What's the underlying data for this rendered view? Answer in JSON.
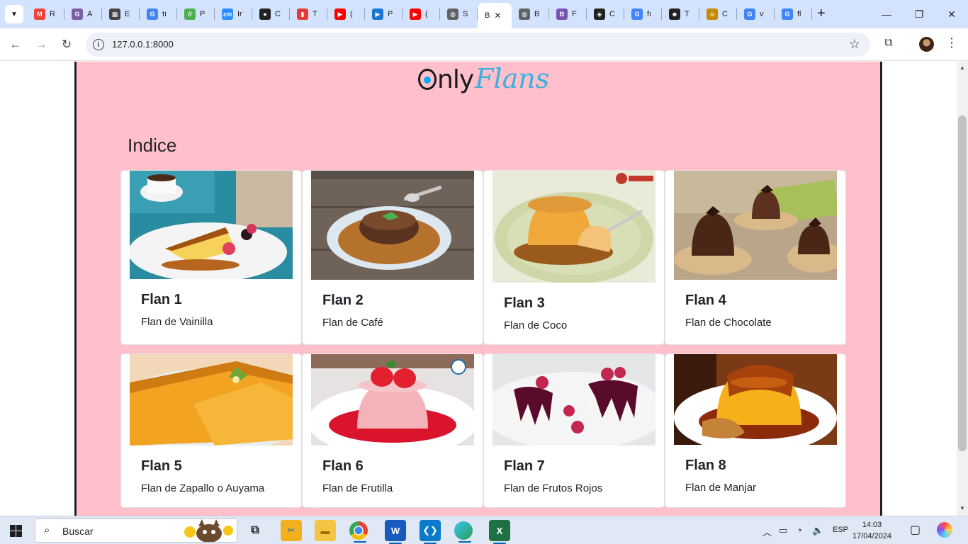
{
  "browser": {
    "tabs": [
      {
        "label": "R",
        "favicon": "gmail-icon",
        "color": "#ea4335",
        "glyph": "M"
      },
      {
        "label": "A",
        "favicon": "app-icon",
        "color": "#7b5ea7",
        "glyph": "G"
      },
      {
        "label": "E",
        "favicon": "chip-icon",
        "color": "#444444",
        "glyph": "▦"
      },
      {
        "label": "tı",
        "favicon": "google-icon",
        "color": "#4285f4",
        "glyph": "G"
      },
      {
        "label": "P",
        "favicon": "page-icon",
        "color": "#4caf50",
        "glyph": "//"
      },
      {
        "label": "Ir",
        "favicon": "zoom-icon",
        "color": "#2d8cff",
        "glyph": "zm"
      },
      {
        "label": "C",
        "favicon": "github-icon",
        "color": "#222222",
        "glyph": "●"
      },
      {
        "label": "T",
        "favicon": "trello-icon",
        "color": "#e53935",
        "glyph": "▮"
      },
      {
        "label": "(",
        "favicon": "youtube-icon",
        "color": "#ff0000",
        "glyph": "▶"
      },
      {
        "label": "P",
        "favicon": "play-icon",
        "color": "#1976d2",
        "glyph": "▶"
      },
      {
        "label": "(",
        "favicon": "youtube-icon",
        "color": "#ff0000",
        "glyph": "▶"
      },
      {
        "label": "S",
        "favicon": "globe-icon",
        "color": "#5f6368",
        "glyph": "◍"
      },
      {
        "label": "B",
        "favicon": "none",
        "color": "#ffffff",
        "glyph": "",
        "active": true
      },
      {
        "label": "B",
        "favicon": "globe-icon",
        "color": "#5f6368",
        "glyph": "◍"
      },
      {
        "label": "F",
        "favicon": "bootstrap-icon",
        "color": "#7952b3",
        "glyph": "B"
      },
      {
        "label": "C",
        "favicon": "codepen-icon",
        "color": "#222222",
        "glyph": "◈"
      },
      {
        "label": "fı",
        "favicon": "google-icon",
        "color": "#4285f4",
        "glyph": "G"
      },
      {
        "label": "T",
        "favicon": "chatbot-icon",
        "color": "#222222",
        "glyph": "☻"
      },
      {
        "label": "C",
        "favicon": "mask-icon",
        "color": "#c58a00",
        "glyph": "☠"
      },
      {
        "label": "v",
        "favicon": "google-icon",
        "color": "#4285f4",
        "glyph": "G"
      },
      {
        "label": "fl",
        "favicon": "google-icon",
        "color": "#4285f4",
        "glyph": "G"
      }
    ],
    "url": "127.0.0.1:8000"
  },
  "page": {
    "logo": {
      "part1": "nly",
      "part2": "Flans"
    },
    "heading": "Indice",
    "background": "#ffc0cb",
    "cards": [
      {
        "title": "Flan 1",
        "text": "Flan de Vainilla"
      },
      {
        "title": "Flan 2",
        "text": "Flan de Café"
      },
      {
        "title": "Flan 3",
        "text": "Flan de Coco"
      },
      {
        "title": "Flan 4",
        "text": "Flan de Chocolate"
      },
      {
        "title": "Flan 5",
        "text": "Flan de Zapallo o Auyama"
      },
      {
        "title": "Flan 6",
        "text": "Flan de Frutilla"
      },
      {
        "title": "Flan 7",
        "text": "Flan de Frutos Rojos"
      },
      {
        "title": "Flan 8",
        "text": "Flan de Manjar"
      }
    ]
  },
  "taskbar": {
    "search_placeholder": "Buscar",
    "language": "ESP",
    "time": "14:03",
    "date": "17/04/2024"
  }
}
